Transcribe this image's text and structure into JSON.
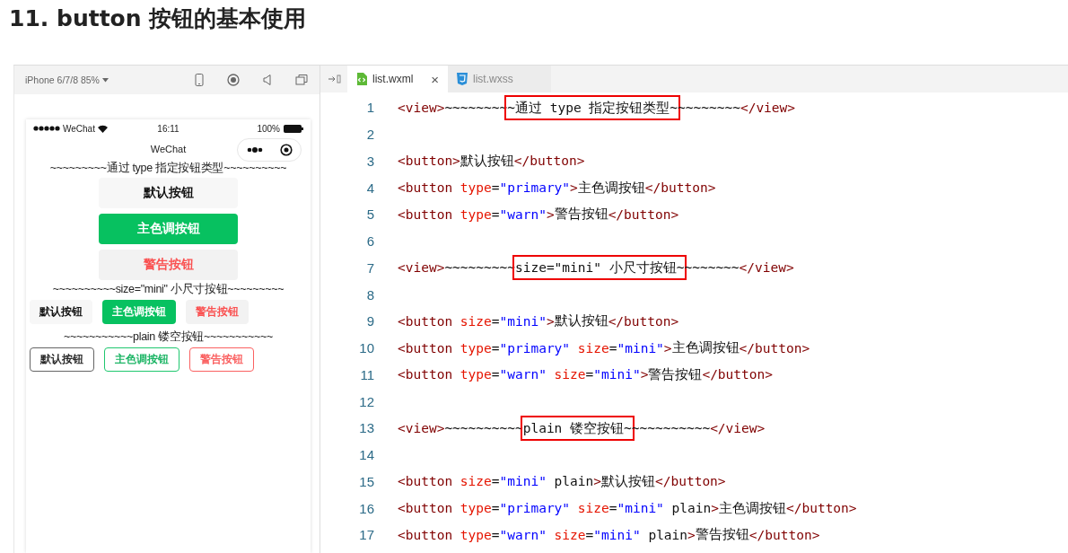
{
  "title": "11. button 按钮的基本使用",
  "simulator": {
    "device": "iPhone 6/7/8 85%",
    "status_bar": {
      "carrier": "WeChat",
      "time": "16:11",
      "battery": "100%"
    },
    "nav_title": "WeChat",
    "sections": [
      {
        "heading": "~~~~~~~~~通过 type 指定按钮类型~~~~~~~~~~",
        "buttons": [
          {
            "label": "默认按钮",
            "kind": "default",
            "mini": false,
            "plain": false
          },
          {
            "label": "主色调按钮",
            "kind": "primary",
            "mini": false,
            "plain": false
          },
          {
            "label": "警告按钮",
            "kind": "warn",
            "mini": false,
            "plain": false
          }
        ]
      },
      {
        "heading": "~~~~~~~~~~size=\"mini\" 小尺寸按钮~~~~~~~~~",
        "buttons": [
          {
            "label": "默认按钮",
            "kind": "default",
            "mini": true,
            "plain": false
          },
          {
            "label": "主色调按钮",
            "kind": "primary",
            "mini": true,
            "plain": false
          },
          {
            "label": "警告按钮",
            "kind": "warn",
            "mini": true,
            "plain": false
          }
        ]
      },
      {
        "heading": "~~~~~~~~~~~plain 镂空按钮~~~~~~~~~~~",
        "buttons": [
          {
            "label": "默认按钮",
            "kind": "default",
            "mini": true,
            "plain": true
          },
          {
            "label": "主色调按钮",
            "kind": "primary",
            "mini": true,
            "plain": true
          },
          {
            "label": "警告按钮",
            "kind": "warn",
            "mini": true,
            "plain": true
          }
        ]
      }
    ]
  },
  "editor": {
    "tabs": [
      {
        "label": "list.wxml",
        "kind": "wxml",
        "selected": true,
        "close": "×"
      },
      {
        "label": "list.wxss",
        "kind": "wxss",
        "selected": false
      }
    ],
    "lines": [
      {
        "number": "1",
        "tokens": [
          {
            "kind": "tag",
            "text": "<view>"
          },
          {
            "kind": "text",
            "text": "~~~~~~~~"
          },
          {
            "kind": "text",
            "text": "~通过 type 指定按钮类型~",
            "highlighted": true
          },
          {
            "kind": "text",
            "text": "~~~~~~~~"
          },
          {
            "kind": "tag",
            "text": "</view>"
          }
        ]
      },
      {
        "number": "2"
      },
      {
        "number": "3",
        "tokens": [
          {
            "kind": "tag",
            "text": "<button>"
          },
          {
            "kind": "text",
            "text": "默认按钮"
          },
          {
            "kind": "tag",
            "text": "</button>"
          }
        ]
      },
      {
        "number": "4",
        "tokens": [
          {
            "kind": "tag",
            "text": "<button "
          },
          {
            "kind": "attr",
            "text": "type"
          },
          {
            "kind": "text",
            "text": "="
          },
          {
            "kind": "value",
            "text": "\"primary\""
          },
          {
            "kind": "tag",
            "text": ">"
          },
          {
            "kind": "text",
            "text": "主色调按钮"
          },
          {
            "kind": "tag",
            "text": "</button>"
          }
        ]
      },
      {
        "number": "5",
        "tokens": [
          {
            "kind": "tag",
            "text": "<button "
          },
          {
            "kind": "attr",
            "text": "type"
          },
          {
            "kind": "text",
            "text": "="
          },
          {
            "kind": "value",
            "text": "\"warn\""
          },
          {
            "kind": "tag",
            "text": ">"
          },
          {
            "kind": "text",
            "text": "警告按钮"
          },
          {
            "kind": "tag",
            "text": "</button>"
          }
        ]
      },
      {
        "number": "6"
      },
      {
        "number": "7",
        "tokens": [
          {
            "kind": "tag",
            "text": "<view>"
          },
          {
            "kind": "text",
            "text": "~~~~~~~~~"
          },
          {
            "kind": "text",
            "text": "size=\"mini\" 小尺寸按钮~",
            "highlighted": true
          },
          {
            "kind": "text",
            "text": "~~~~~~~"
          },
          {
            "kind": "tag",
            "text": "</view>"
          }
        ]
      },
      {
        "number": "8"
      },
      {
        "number": "9",
        "tokens": [
          {
            "kind": "tag",
            "text": "<button "
          },
          {
            "kind": "attr",
            "text": "size"
          },
          {
            "kind": "text",
            "text": "="
          },
          {
            "kind": "value",
            "text": "\"mini\""
          },
          {
            "kind": "tag",
            "text": ">"
          },
          {
            "kind": "text",
            "text": "默认按钮"
          },
          {
            "kind": "tag",
            "text": "</button>"
          }
        ]
      },
      {
        "number": "10",
        "tokens": [
          {
            "kind": "tag",
            "text": "<button "
          },
          {
            "kind": "attr",
            "text": "type"
          },
          {
            "kind": "text",
            "text": "="
          },
          {
            "kind": "value",
            "text": "\"primary\""
          },
          {
            "kind": "attr",
            "text": " size"
          },
          {
            "kind": "text",
            "text": "="
          },
          {
            "kind": "value",
            "text": "\"mini\""
          },
          {
            "kind": "tag",
            "text": ">"
          },
          {
            "kind": "text",
            "text": "主色调按钮"
          },
          {
            "kind": "tag",
            "text": "</button>"
          }
        ]
      },
      {
        "number": "11",
        "tokens": [
          {
            "kind": "tag",
            "text": "<button "
          },
          {
            "kind": "attr",
            "text": "type"
          },
          {
            "kind": "text",
            "text": "="
          },
          {
            "kind": "value",
            "text": "\"warn\""
          },
          {
            "kind": "attr",
            "text": " size"
          },
          {
            "kind": "text",
            "text": "="
          },
          {
            "kind": "value",
            "text": "\"mini\""
          },
          {
            "kind": "tag",
            "text": ">"
          },
          {
            "kind": "text",
            "text": "警告按钮"
          },
          {
            "kind": "tag",
            "text": "</button>"
          }
        ]
      },
      {
        "number": "12"
      },
      {
        "number": "13",
        "tokens": [
          {
            "kind": "tag",
            "text": "<view>"
          },
          {
            "kind": "text",
            "text": "~~~~~~~~~~"
          },
          {
            "kind": "text",
            "text": "plain 镂空按钮~",
            "highlighted": true
          },
          {
            "kind": "text",
            "text": "~~~~~~~~~~"
          },
          {
            "kind": "tag",
            "text": "</view>"
          }
        ]
      },
      {
        "number": "14"
      },
      {
        "number": "15",
        "tokens": [
          {
            "kind": "tag",
            "text": "<button "
          },
          {
            "kind": "attr",
            "text": "size"
          },
          {
            "kind": "text",
            "text": "="
          },
          {
            "kind": "value",
            "text": "\"mini\""
          },
          {
            "kind": "text",
            "text": " plain"
          },
          {
            "kind": "tag",
            "text": ">"
          },
          {
            "kind": "text",
            "text": "默认按钮"
          },
          {
            "kind": "tag",
            "text": "</button>"
          }
        ]
      },
      {
        "number": "16",
        "tokens": [
          {
            "kind": "tag",
            "text": "<button "
          },
          {
            "kind": "attr",
            "text": "type"
          },
          {
            "kind": "text",
            "text": "="
          },
          {
            "kind": "value",
            "text": "\"primary\""
          },
          {
            "kind": "attr",
            "text": " size"
          },
          {
            "kind": "text",
            "text": "="
          },
          {
            "kind": "value",
            "text": "\"mini\""
          },
          {
            "kind": "text",
            "text": " plain"
          },
          {
            "kind": "tag",
            "text": ">"
          },
          {
            "kind": "text",
            "text": "主色调按钮"
          },
          {
            "kind": "tag",
            "text": "</button>"
          }
        ]
      },
      {
        "number": "17",
        "tokens": [
          {
            "kind": "tag",
            "text": "<button "
          },
          {
            "kind": "attr",
            "text": "type"
          },
          {
            "kind": "text",
            "text": "="
          },
          {
            "kind": "value",
            "text": "\"warn\""
          },
          {
            "kind": "attr",
            "text": " size"
          },
          {
            "kind": "text",
            "text": "="
          },
          {
            "kind": "value",
            "text": "\"mini\""
          },
          {
            "kind": "text",
            "text": " plain"
          },
          {
            "kind": "tag",
            "text": ">"
          },
          {
            "kind": "text",
            "text": "警告按钮"
          },
          {
            "kind": "tag",
            "text": "</button>"
          }
        ]
      }
    ]
  }
}
